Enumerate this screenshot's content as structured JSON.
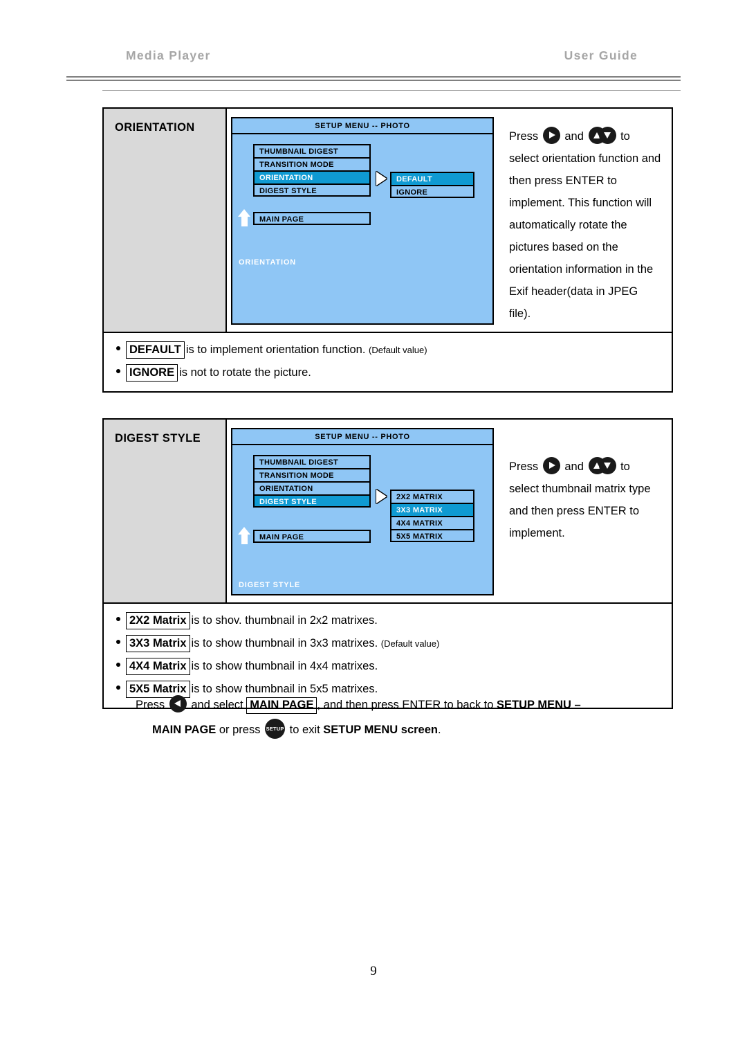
{
  "header": {
    "left_title": "Media  Player",
    "right_title": "User  Guide"
  },
  "page_number": "9",
  "sections": [
    {
      "label": "ORIENTATION",
      "osd": {
        "title": "SETUP MENU -- PHOTO",
        "menu_items": [
          {
            "label": "THUMBNAIL DIGEST",
            "selected": false
          },
          {
            "label": "TRANSITION MODE",
            "selected": false
          },
          {
            "label": "ORIENTATION",
            "selected": true
          },
          {
            "label": "DIGEST STYLE",
            "selected": false
          }
        ],
        "submenu_items": [
          {
            "label": "DEFAULT",
            "selected": true
          },
          {
            "label": "IGNORE",
            "selected": false
          }
        ],
        "main_page_label": "MAIN PAGE",
        "footer_label": "ORIENTATION"
      },
      "description": {
        "press_word": "Press",
        "and_word": "and",
        "to_word": "to",
        "body": "select orientation function and then press ENTER to implement. This function will automatically rotate the pictures based on the orientation information in the Exif header(data in JPEG  file)."
      },
      "bullets": [
        {
          "boxed": "DEFAULT",
          "text": "is to implement orientation function.",
          "note": "(Default value)"
        },
        {
          "boxed": "IGNORE",
          "text": "is not to rotate the picture.",
          "note": ""
        }
      ]
    },
    {
      "label": "DIGEST STYLE",
      "osd": {
        "title": "SETUP MENU -- PHOTO",
        "menu_items": [
          {
            "label": "THUMBNAIL DIGEST",
            "selected": false
          },
          {
            "label": "TRANSITION MODE",
            "selected": false
          },
          {
            "label": "ORIENTATION",
            "selected": false
          },
          {
            "label": "DIGEST STYLE",
            "selected": true
          }
        ],
        "submenu_items": [
          {
            "label": "2X2 MATRIX",
            "selected": false
          },
          {
            "label": "3X3 MATRIX",
            "selected": true
          },
          {
            "label": "4X4 MATRIX",
            "selected": false
          },
          {
            "label": "5X5 MATRIX",
            "selected": false
          }
        ],
        "main_page_label": "MAIN PAGE",
        "footer_label": "DIGEST STYLE"
      },
      "description": {
        "press_word": "Press",
        "and_word": "and",
        "to_word": "to",
        "body": "select thumbnail matrix type and then press ENTER to implement."
      },
      "bullets": [
        {
          "boxed": "2X2 Matrix",
          "text": "is to shov. thumbnail in 2x2 matrixes.",
          "note": ""
        },
        {
          "boxed": "3X3 Matrix",
          "text": "is to show thumbnail in 3x3 matrixes.",
          "note": "(Default value)"
        },
        {
          "boxed": "4X4 Matrix",
          "text": "is to show thumbnail in 4x4 matrixes.",
          "note": ""
        },
        {
          "boxed": "5X5 Matrix",
          "text": "is to show thumbnail in 5x5 matrixes.",
          "note": ""
        }
      ]
    }
  ],
  "closing": {
    "press_word": "Press",
    "seg_and_select": "and select",
    "boxed_main_page": "MAIN PAGE",
    "seg_then_press": ", and then press ENTER to back to",
    "bold_setup_menu": "SETUP MENU –",
    "line2_main_page": "MAIN PAGE",
    "line2_or_press": "or press",
    "line2_to_exit": "to exit",
    "line2_setup_menu": "SETUP MENU",
    "line2_screen": "screen",
    "line2_period": "."
  },
  "icons": {
    "setup_button_label": "SETUP"
  },
  "colors": {
    "osd_background": "#8fc6f5",
    "osd_highlight": "#0f9ad2",
    "label_cell_background": "#d9d9d9",
    "header_text": "#a6a6a6"
  }
}
